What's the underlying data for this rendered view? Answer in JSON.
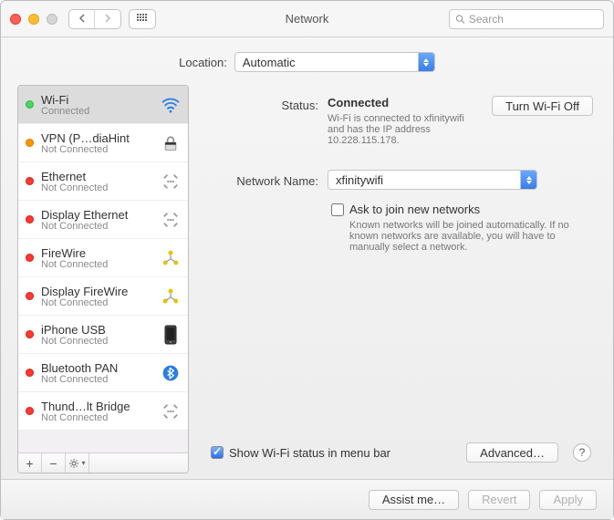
{
  "window": {
    "title": "Network",
    "search_placeholder": "Search"
  },
  "location": {
    "label": "Location:",
    "selected": "Automatic"
  },
  "sidebar": {
    "items": [
      {
        "name": "Wi-Fi",
        "status": "Connected",
        "dot": "green",
        "icon": "wifi",
        "selected": true
      },
      {
        "name": "VPN (P…diaHint",
        "status": "Not Connected",
        "dot": "orange",
        "icon": "lock"
      },
      {
        "name": "Ethernet",
        "status": "Not Connected",
        "dot": "red",
        "icon": "ethernet"
      },
      {
        "name": "Display Ethernet",
        "status": "Not Connected",
        "dot": "red",
        "icon": "ethernet"
      },
      {
        "name": "FireWire",
        "status": "Not Connected",
        "dot": "red",
        "icon": "firewire-y"
      },
      {
        "name": "Display FireWire",
        "status": "Not Connected",
        "dot": "red",
        "icon": "firewire-y"
      },
      {
        "name": "iPhone USB",
        "status": "Not Connected",
        "dot": "red",
        "icon": "phone"
      },
      {
        "name": "Bluetooth PAN",
        "status": "Not Connected",
        "dot": "red",
        "icon": "bluetooth"
      },
      {
        "name": "Thund…lt Bridge",
        "status": "Not Connected",
        "dot": "red",
        "icon": "thunderbolt"
      }
    ]
  },
  "main": {
    "status_label": "Status:",
    "status_value": "Connected",
    "turn_off_label": "Turn Wi-Fi Off",
    "status_desc": "Wi-Fi is connected to xfinitywifi and has the IP address 10.228.115.178.",
    "network_name_label": "Network Name:",
    "network_name_value": "xfinitywifi",
    "ask_label": "Ask to join new networks",
    "ask_desc": "Known networks will be joined automatically. If no known networks are available, you will have to manually select a network.",
    "show_status_label": "Show Wi-Fi status in menu bar",
    "advanced_label": "Advanced…"
  },
  "footer": {
    "assist_label": "Assist me…",
    "revert_label": "Revert",
    "apply_label": "Apply"
  }
}
